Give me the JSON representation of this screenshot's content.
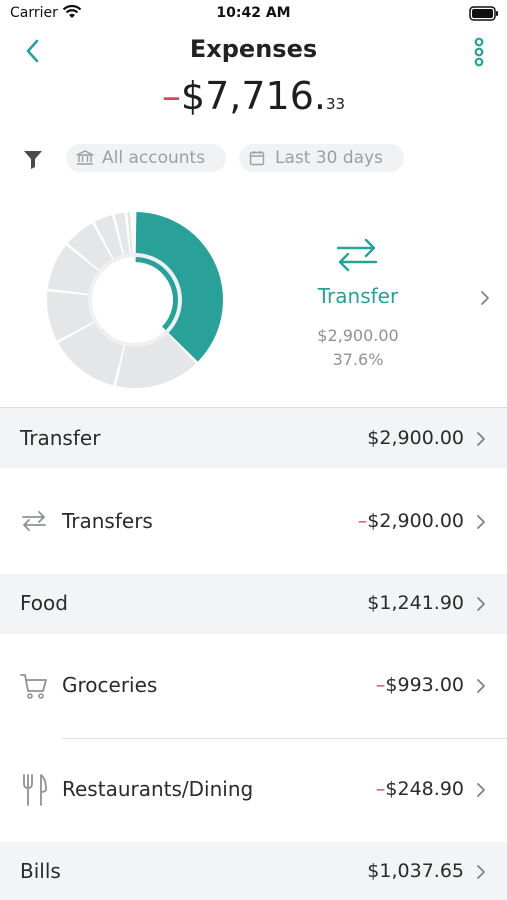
{
  "status_bar": {
    "carrier": "Carrier",
    "time": "10:42 AM"
  },
  "header": {
    "title": "Expenses",
    "total_sign": "–",
    "total_main": "$7,716.",
    "total_cents": "33"
  },
  "filters": {
    "accounts": "All accounts",
    "date_range": "Last 30 days"
  },
  "colors": {
    "accent": "#2aa198",
    "negative": "#d9455c",
    "segment": "#e4e6e7"
  },
  "chart_data": {
    "type": "pie",
    "style": "donut",
    "highlighted": "Transfer",
    "slices": [
      {
        "category": "Transfer",
        "value": 2900.0
      },
      {
        "category": "Food",
        "value": 1241.9
      },
      {
        "category": "Bills",
        "value": 1037.65
      },
      {
        "value": 750
      },
      {
        "value": 700
      },
      {
        "value": 480
      },
      {
        "value": 300
      },
      {
        "value": 180
      },
      {
        "value": 80
      },
      {
        "value": 46.78
      }
    ]
  },
  "selected": {
    "icon": "transfer-arrows-icon",
    "name": "Transfer",
    "amount": "$2,900.00",
    "percent": "37.6%"
  },
  "rows": [
    {
      "type": "category",
      "name": "Transfer",
      "amount": "$2,900.00"
    },
    {
      "type": "item",
      "icon": "transfer-arrows-icon",
      "name": "Transfers",
      "sign": "–",
      "amount": "$2,900.00"
    },
    {
      "type": "category",
      "name": "Food",
      "amount": "$1,241.90"
    },
    {
      "type": "item",
      "icon": "cart-icon",
      "name": "Groceries",
      "sign": "–",
      "amount": "$993.00"
    },
    {
      "type": "item",
      "icon": "fork-knife-icon",
      "name": "Restaurants/Dining",
      "sign": "–",
      "amount": "$248.90"
    },
    {
      "type": "category",
      "name": "Bills",
      "amount": "$1,037.65"
    }
  ]
}
